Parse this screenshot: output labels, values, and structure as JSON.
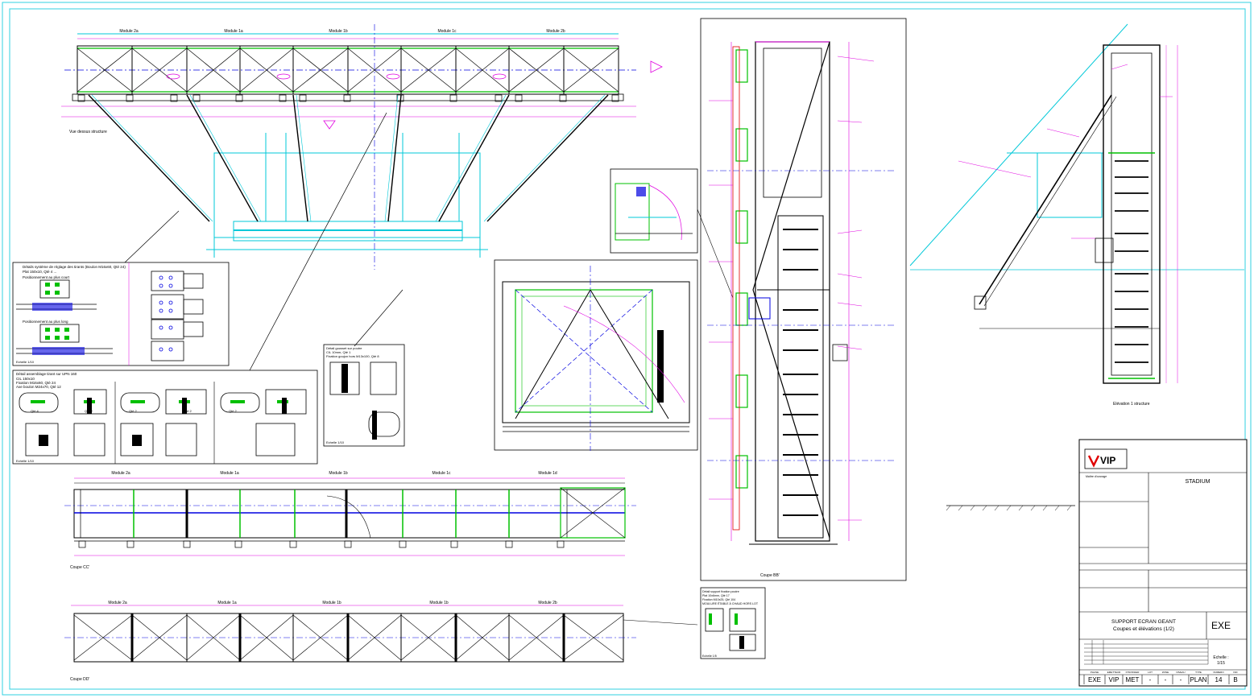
{
  "views": {
    "top_view": {
      "caption": "Vue dessus structure",
      "modules": [
        "Module 2a",
        "Module 1a",
        "Module 1b",
        "Module 1c",
        "Module 2b"
      ]
    },
    "section_cc": {
      "caption": "Coupe CC'",
      "modules": [
        "Module 2a",
        "Module 1a",
        "Module 1b",
        "Module 1c",
        "Module 1d"
      ]
    },
    "section_dd": {
      "caption": "Coupe DD'",
      "modules": [
        "Module 2a",
        "Module 1a",
        "Module 1b",
        "Module 1b",
        "Module 2b"
      ]
    },
    "section_bb": {
      "caption": "Coupe BB'"
    },
    "elevation": {
      "caption": "Elévation 1 structure"
    }
  },
  "details": {
    "tie_rod": {
      "title": "Détails système de réglage des tirants (Boulon M16x60, Qté 24)",
      "subtitle": "Plat 150x10, Qté 4 ...",
      "pos_short": "Positionnement au plus court",
      "pos_long": "Positionnement au plus long",
      "scale": "Echelle 1/10"
    },
    "upn_assembly": {
      "title": "Détail assemblage tirant sur UPN 160",
      "lines": [
        "CIL 150x10",
        "Fixation M16x60, Qté 24",
        "Axe boulon M24x70, Qté 12"
      ],
      "labels": [
        "Qté 4",
        "Qté 2",
        "Qté 2",
        "Qté 2",
        "Qté 2"
      ],
      "scale": "Echelle 1/10"
    },
    "gusset": {
      "title": "Détail gousset sur poutre",
      "lines": [
        "CIL 10mm, Qté 1",
        "Fixation goujon hors M13x100, Qté 8"
      ],
      "scale": "Echelle 1/10"
    },
    "bracket": {
      "title": "Détail support fixation poutre",
      "lines": [
        "Plat 10x6mm, Qté 17",
        "Fixation M10x25, Qté 104",
        "MOULURE ÉTABLE À CHAUD HORS LOT"
      ],
      "scale": "Echelle 1/5"
    }
  },
  "title_block": {
    "logo": "VIP",
    "client_label": "Maître d'ouvrage",
    "project": "STADIUM",
    "drawing_title_1": "SUPPORT ECRAN GEANT",
    "drawing_title_2": "Coupes et élévations (1/2)",
    "phase": "EXE",
    "scale_label": "Echelle :",
    "scale_value": "1/15",
    "footer_headers": [
      "PHASE",
      "EMETTEUR",
      "N°DOSSIER",
      "LOT",
      "ZONE",
      "NIVEAU",
      "TYPE",
      "NUMERO",
      "IND"
    ],
    "footer_values": [
      "EXE",
      "VIP",
      "MET",
      "-",
      "-",
      "-",
      "PLAN",
      "14",
      "B"
    ]
  },
  "colors": {
    "steel": "#000000",
    "structure_cyan": "#00c8d8",
    "dimension_magenta": "#e000e0",
    "green": "#00c000",
    "red": "#e00000",
    "blue": "#0000e0",
    "frame": "#30d0e0"
  }
}
